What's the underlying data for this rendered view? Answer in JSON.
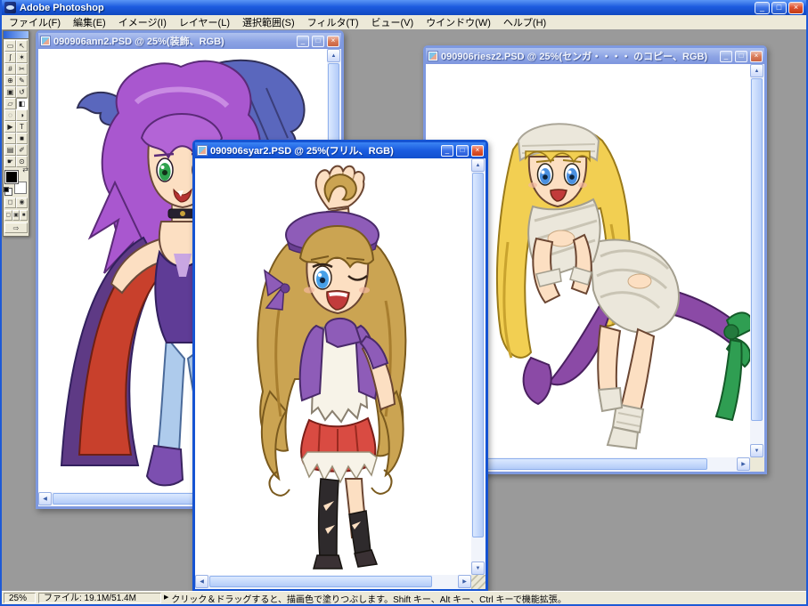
{
  "app": {
    "title": "Adobe Photoshop",
    "controls": {
      "minimize": "_",
      "maximize": "□",
      "close": "×"
    }
  },
  "menus": [
    "ファイル(F)",
    "編集(E)",
    "イメージ(I)",
    "レイヤー(L)",
    "選択範囲(S)",
    "フィルタ(T)",
    "ビュー(V)",
    "ウインドウ(W)",
    "ヘルプ(H)"
  ],
  "toolbox": {
    "tools": [
      {
        "name": "rectangular-marquee",
        "glyph": "▭"
      },
      {
        "name": "move",
        "glyph": "↖"
      },
      {
        "name": "lasso",
        "glyph": "ʃ"
      },
      {
        "name": "magic-wand",
        "glyph": "✶"
      },
      {
        "name": "crop",
        "glyph": "#"
      },
      {
        "name": "slice",
        "glyph": "✂"
      },
      {
        "name": "healing-brush",
        "glyph": "⊕"
      },
      {
        "name": "brush",
        "glyph": "✎"
      },
      {
        "name": "clone-stamp",
        "glyph": "▣"
      },
      {
        "name": "history-brush",
        "glyph": "↺"
      },
      {
        "name": "eraser",
        "glyph": "▱"
      },
      {
        "name": "paint-bucket",
        "glyph": "◧"
      },
      {
        "name": "blur",
        "glyph": "◌"
      },
      {
        "name": "dodge",
        "glyph": "◑"
      },
      {
        "name": "path-selection",
        "glyph": "▶"
      },
      {
        "name": "type",
        "glyph": "T"
      },
      {
        "name": "pen",
        "glyph": "✒"
      },
      {
        "name": "shape",
        "glyph": "■"
      },
      {
        "name": "notes",
        "glyph": "▤"
      },
      {
        "name": "eyedropper",
        "glyph": "✐"
      },
      {
        "name": "hand",
        "glyph": "☛"
      },
      {
        "name": "zoom",
        "glyph": "⊙"
      }
    ],
    "foreground_color": "#000000",
    "background_color": "#ffffff",
    "swap_glyph": "⇄",
    "mask_modes": [
      "◻",
      "◉"
    ],
    "screen_modes": [
      "▢",
      "▣",
      "■"
    ],
    "imageready_glyph": "⇨"
  },
  "windows": [
    {
      "id": "ann2",
      "title": "090906ann2.PSD @ 25%(装飾、RGB)",
      "active": false
    },
    {
      "id": "riesz2",
      "title": "090906riesz2.PSD @ 25%(センガ・・・・ のコピー、RGB)",
      "active": false
    },
    {
      "id": "syar2",
      "title": "090906syar2.PSD @ 25%(フリル、RGB)",
      "active": true
    }
  ],
  "scrollbar": {
    "up": "▲",
    "down": "▼",
    "left": "◀",
    "right": "▶"
  },
  "status_bar": {
    "zoom": "25%",
    "file_info": "ファイル: 19.1M/51.4M",
    "popup_arrow": "▶",
    "tip": "クリック＆ドラッグすると、描画色で塗りつぶします。Shift キー、Alt キー、Ctrl キーで機能拡張。"
  },
  "palette": {
    "titlebar_active_blue": "#1A5CE0",
    "titlebar_inactive_blue": "#8CA3E4",
    "close_button_red": "#DE5230",
    "menu_bg": "#ECE9D8",
    "workspace_gray": "#9A9A9A",
    "canvas_white": "#FFFFFF"
  }
}
